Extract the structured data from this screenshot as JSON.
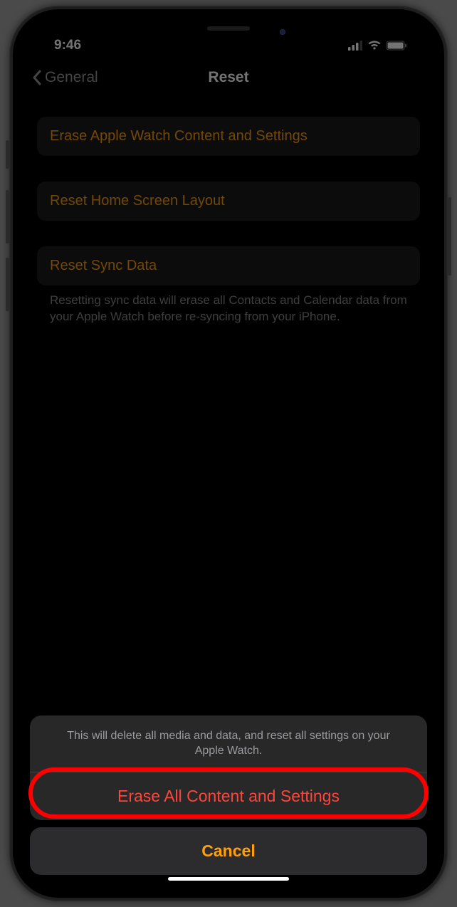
{
  "status": {
    "time": "9:46"
  },
  "nav": {
    "back_label": "General",
    "title": "Reset"
  },
  "settings": {
    "erase": "Erase Apple Watch Content and Settings",
    "reset_home": "Reset Home Screen Layout",
    "reset_sync": "Reset Sync Data",
    "sync_note": "Resetting sync data will erase all Contacts and Calendar data from your Apple Watch before re-syncing from your iPhone."
  },
  "sheet": {
    "message": "This will delete all media and data, and reset all settings on your Apple Watch.",
    "erase_action": "Erase All Content and Settings",
    "cancel": "Cancel"
  }
}
